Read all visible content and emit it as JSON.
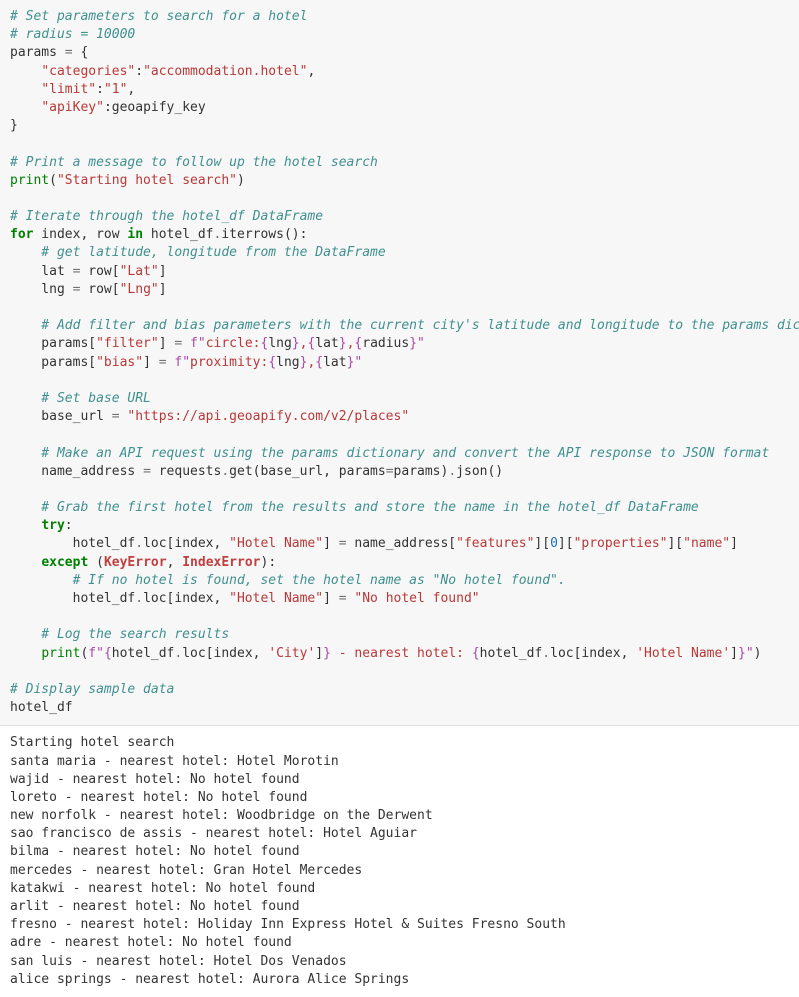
{
  "code": {
    "c1": "# Set parameters to search for a hotel",
    "c2": "# radius = 10000",
    "l3a": "params ",
    "l3b": "=",
    "l3c": " {",
    "l4a": "    ",
    "l4b": "\"categories\"",
    "l4c": ":",
    "l4d": "\"accommodation.hotel\"",
    "l4e": ",",
    "l5a": "    ",
    "l5b": "\"limit\"",
    "l5c": ":",
    "l5d": "\"1\"",
    "l5e": ",",
    "l6a": "    ",
    "l6b": "\"apiKey\"",
    "l6c": ":geoapify_key",
    "l7": "}",
    "c8": "# Print a message to follow up the hotel search",
    "l9a": "print",
    "l9b": "(",
    "l9c": "\"Starting hotel search\"",
    "l9d": ")",
    "c10": "# Iterate through the hotel_df DataFrame",
    "l11a": "for",
    "l11b": " index, row ",
    "l11c": "in",
    "l11d": " hotel_df",
    "l11e": ".",
    "l11f": "iterrows():",
    "c12": "    # get latitude, longitude from the DataFrame",
    "l13a": "    lat ",
    "l13b": "=",
    "l13c": " row[",
    "l13d": "\"Lat\"",
    "l13e": "]",
    "l14a": "    lng ",
    "l14b": "=",
    "l14c": " row[",
    "l14d": "\"Lng\"",
    "l14e": "]",
    "c15": "    # Add filter and bias parameters with the current city's latitude and longitude to the params dictionary",
    "l16a": "    params[",
    "l16b": "\"filter\"",
    "l16c": "] ",
    "l16d": "=",
    "l16e": " ",
    "l16f": "f\"",
    "l16g": "circle:",
    "l16h": "{",
    "l16i": "lng",
    "l16j": "}",
    "l16k": ",",
    "l16l": "{",
    "l16m": "lat",
    "l16n": "}",
    "l16o": ",",
    "l16p": "{",
    "l16q": "radius",
    "l16r": "}",
    "l16s": "\"",
    "l17a": "    params[",
    "l17b": "\"bias\"",
    "l17c": "] ",
    "l17d": "=",
    "l17e": " ",
    "l17f": "f\"",
    "l17g": "proximity:",
    "l17h": "{",
    "l17i": "lng",
    "l17j": "}",
    "l17k": ",",
    "l17l": "{",
    "l17m": "lat",
    "l17n": "}",
    "l17o": "\"",
    "c18": "    # Set base URL",
    "l19a": "    base_url ",
    "l19b": "=",
    "l19c": " ",
    "l19d": "\"https://api.geoapify.com/v2/places\"",
    "c20": "    # Make an API request using the params dictionary and convert the API response to JSON format",
    "l21a": "    name_address ",
    "l21b": "=",
    "l21c": " requests",
    "l21d": ".",
    "l21e": "get(base_url, params",
    "l21f": "=",
    "l21g": "params)",
    "l21h": ".",
    "l21i": "json()",
    "c22": "    # Grab the first hotel from the results and store the name in the hotel_df DataFrame",
    "l23a": "    ",
    "l23b": "try",
    "l23c": ":",
    "l24a": "        hotel_df",
    "l24b": ".",
    "l24c": "loc[index, ",
    "l24d": "\"Hotel Name\"",
    "l24e": "] ",
    "l24f": "=",
    "l24g": " name_address[",
    "l24h": "\"features\"",
    "l24i": "][",
    "l24j": "0",
    "l24k": "][",
    "l24l": "\"properties\"",
    "l24m": "][",
    "l24n": "\"name\"",
    "l24o": "]",
    "l25a": "    ",
    "l25b": "except",
    "l25c": " (",
    "l25d": "KeyError",
    "l25e": ", ",
    "l25f": "IndexError",
    "l25g": "):",
    "c26": "        # If no hotel is found, set the hotel name as \"No hotel found\".",
    "l27a": "        hotel_df",
    "l27b": ".",
    "l27c": "loc[index, ",
    "l27d": "\"Hotel Name\"",
    "l27e": "] ",
    "l27f": "=",
    "l27g": " ",
    "l27h": "\"No hotel found\"",
    "c28": "    # Log the search results",
    "l29a": "    ",
    "l29b": "print",
    "l29c": "(",
    "l29d": "f\"",
    "l29e": "{",
    "l29f": "hotel_df",
    "l29g": ".",
    "l29h": "loc[index,",
    "l29i": " ",
    "l29j": "'City'",
    "l29k": "]",
    "l29l": "}",
    "l29m": " - nearest hotel: ",
    "l29n": "{",
    "l29o": "hotel_df",
    "l29p": ".",
    "l29q": "loc[index,",
    "l29r": " ",
    "l29s": "'Hotel Name'",
    "l29t": "]",
    "l29u": "}",
    "l29v": "\"",
    "l29w": ")",
    "c30": "# Display sample data",
    "l31": "hotel_df"
  },
  "output": {
    "lines": [
      "Starting hotel search",
      "santa maria - nearest hotel: Hotel Morotin",
      "wajid - nearest hotel: No hotel found",
      "loreto - nearest hotel: No hotel found",
      "new norfolk - nearest hotel: Woodbridge on the Derwent",
      "sao francisco de assis - nearest hotel: Hotel Aguiar",
      "bilma - nearest hotel: No hotel found",
      "mercedes - nearest hotel: Gran Hotel Mercedes",
      "katakwi - nearest hotel: No hotel found",
      "arlit - nearest hotel: No hotel found",
      "fresno - nearest hotel: Holiday Inn Express Hotel & Suites Fresno South",
      "adre - nearest hotel: No hotel found",
      "san luis - nearest hotel: Hotel Dos Venados",
      "alice springs - nearest hotel: Aurora Alice Springs"
    ]
  }
}
